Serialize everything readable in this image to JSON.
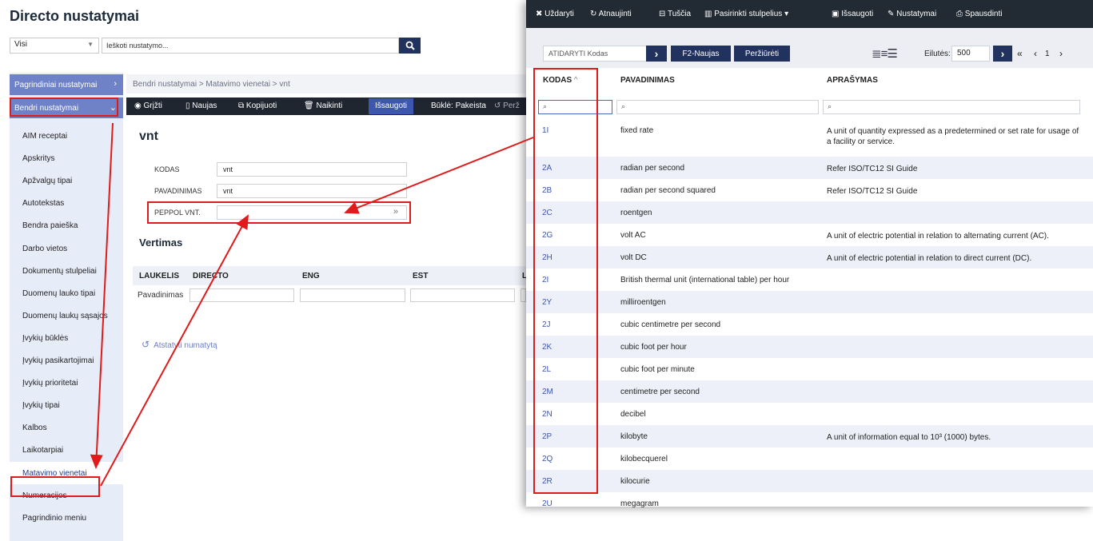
{
  "app": {
    "title": "Directo nustatymai"
  },
  "filter": {
    "selected": "Visi",
    "search_placeholder": "Ieškoti nustatymo..."
  },
  "sidebar": {
    "group1": "Pagrindiniai nustatymai",
    "group2": "Bendri nustatymai",
    "items": [
      "AIM receptai",
      "Apskritys",
      "Apžvalgų tipai",
      "Autotekstas",
      "Bendra paieška",
      "Darbo vietos",
      "Dokumentų stulpeliai",
      "Duomenų lauko tipai",
      "Duomenų laukų sąsajos",
      "Įvykių būklės",
      "Įvykių pasikartojimai",
      "Įvykių prioritetai",
      "Įvykių tipai",
      "Kalbos",
      "Laikotarpiai",
      "Matavimo vienetai",
      "Numeracijos",
      "Pagrindinio meniu"
    ],
    "active_index": 15
  },
  "breadcrumb": "Bendri nustatymai > Matavimo vienetai > vnt",
  "toolbar": {
    "back": "Grįžti",
    "new": "Naujas",
    "copy": "Kopijuoti",
    "delete": "Naikinti",
    "save": "Išsaugoti",
    "status": "Būklė: Pakeista",
    "more": "Perž"
  },
  "record": {
    "title": "vnt",
    "fields": [
      {
        "label": "KODAS",
        "value": "vnt"
      },
      {
        "label": "PAVADINIMAS",
        "value": "vnt"
      },
      {
        "label": "PEPPOL VNT.",
        "value": ""
      }
    ],
    "picker_glyph": "»"
  },
  "translation": {
    "title": "Vertimas",
    "headers": [
      "LAUKELIS",
      "DIRECTO",
      "ENG",
      "EST",
      "L"
    ],
    "row_label": "Pavadinimas"
  },
  "restore": "Atstatyti numatytą",
  "popup": {
    "top": {
      "close": "Uždaryti",
      "refresh": "Atnaujinti",
      "clear": "Tuščia",
      "columns": "Pasirinkti stulpelius",
      "save": "Išsaugoti",
      "settings": "Nustatymai",
      "print": "Spausdinti"
    },
    "open_placeholder": "ATIDARYTI Kodas",
    "f2_new": "F2-Naujas",
    "view": "Peržiūrėti",
    "rows_label": "Eilutės:",
    "rows_value": "500",
    "page": "1",
    "headers": {
      "code": "KODAS",
      "name": "PAVADINIMAS",
      "desc": "APRAŠYMAS"
    },
    "sort_glyph": "^",
    "rows": [
      {
        "code": "1I",
        "name": "fixed rate",
        "desc": "A unit of quantity expressed as a predetermined or set rate for usage of a facility or service."
      },
      {
        "code": "2A",
        "name": "radian per second",
        "desc": "Refer ISO/TC12 SI Guide"
      },
      {
        "code": "2B",
        "name": "radian per second squared",
        "desc": "Refer ISO/TC12 SI Guide"
      },
      {
        "code": "2C",
        "name": "roentgen",
        "desc": ""
      },
      {
        "code": "2G",
        "name": "volt AC",
        "desc": "A unit of electric potential in relation to alternating current (AC)."
      },
      {
        "code": "2H",
        "name": "volt DC",
        "desc": "A unit of electric potential in relation to direct current (DC)."
      },
      {
        "code": "2I",
        "name": "British thermal unit (international table) per hour",
        "desc": ""
      },
      {
        "code": "2Y",
        "name": "milliroentgen",
        "desc": ""
      },
      {
        "code": "2J",
        "name": "cubic centimetre per second",
        "desc": ""
      },
      {
        "code": "2K",
        "name": "cubic foot per hour",
        "desc": ""
      },
      {
        "code": "2L",
        "name": "cubic foot per minute",
        "desc": ""
      },
      {
        "code": "2M",
        "name": "centimetre per second",
        "desc": ""
      },
      {
        "code": "2N",
        "name": "decibel",
        "desc": ""
      },
      {
        "code": "2P",
        "name": "kilobyte",
        "desc": "A unit of information equal to 10³ (1000) bytes."
      },
      {
        "code": "2Q",
        "name": "kilobecquerel",
        "desc": ""
      },
      {
        "code": "2R",
        "name": "kilocurie",
        "desc": ""
      },
      {
        "code": "2U",
        "name": "megagram",
        "desc": ""
      }
    ]
  },
  "colors": {
    "annotation": "#e01b1b",
    "accent": "#22325f",
    "link": "#3d56b0"
  }
}
